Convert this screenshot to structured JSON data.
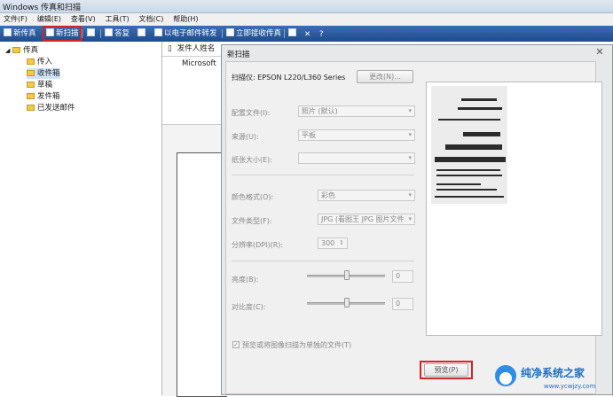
{
  "window": {
    "title": "Windows 传真和扫描"
  },
  "menu": [
    "文件(F)",
    "编辑(E)",
    "查看(V)",
    "工具(T)",
    "文档(C)",
    "帮助(H)"
  ],
  "toolbar": {
    "new_fax": "新传真",
    "new_scan": "新扫描",
    "reply": "答复",
    "forward_email": "以电子邮件转发",
    "forward_fax": "立即接收传真"
  },
  "tree": {
    "root": "传真",
    "items": [
      "传入",
      "收件箱",
      "草稿",
      "发件箱",
      "已发送邮件"
    ],
    "selected": "收件箱"
  },
  "list": {
    "header": "发件人姓名",
    "row1": "Microsoft"
  },
  "dialog": {
    "title": "新扫描",
    "scanner_label": "扫描仪: EPSON L220/L360 Series",
    "change_button": "更改(N)...",
    "profile_label": "配置文件(I):",
    "profile_value": "照片 (默认)",
    "source_label": "来源(U):",
    "source_value": "平板",
    "paper_label": "纸张大小(E):",
    "paper_value": "",
    "color_label": "颜色格式(O):",
    "color_value": "彩色",
    "filetype_label": "文件类型(F):",
    "filetype_value": "JPG (看图王 JPG 图片文件",
    "dpi_label": "分辨率(DPI)(R):",
    "dpi_value": "300",
    "brightness_label": "亮度(B):",
    "brightness_value": "0",
    "contrast_label": "对比度(C):",
    "contrast_value": "0",
    "separate_files": "预览或将图像扫描为单独的文件(T)",
    "preview_button": "预览(P)"
  },
  "watermark": {
    "line1": "纯净系统之家",
    "line2": "www.ycwjzy.com"
  }
}
